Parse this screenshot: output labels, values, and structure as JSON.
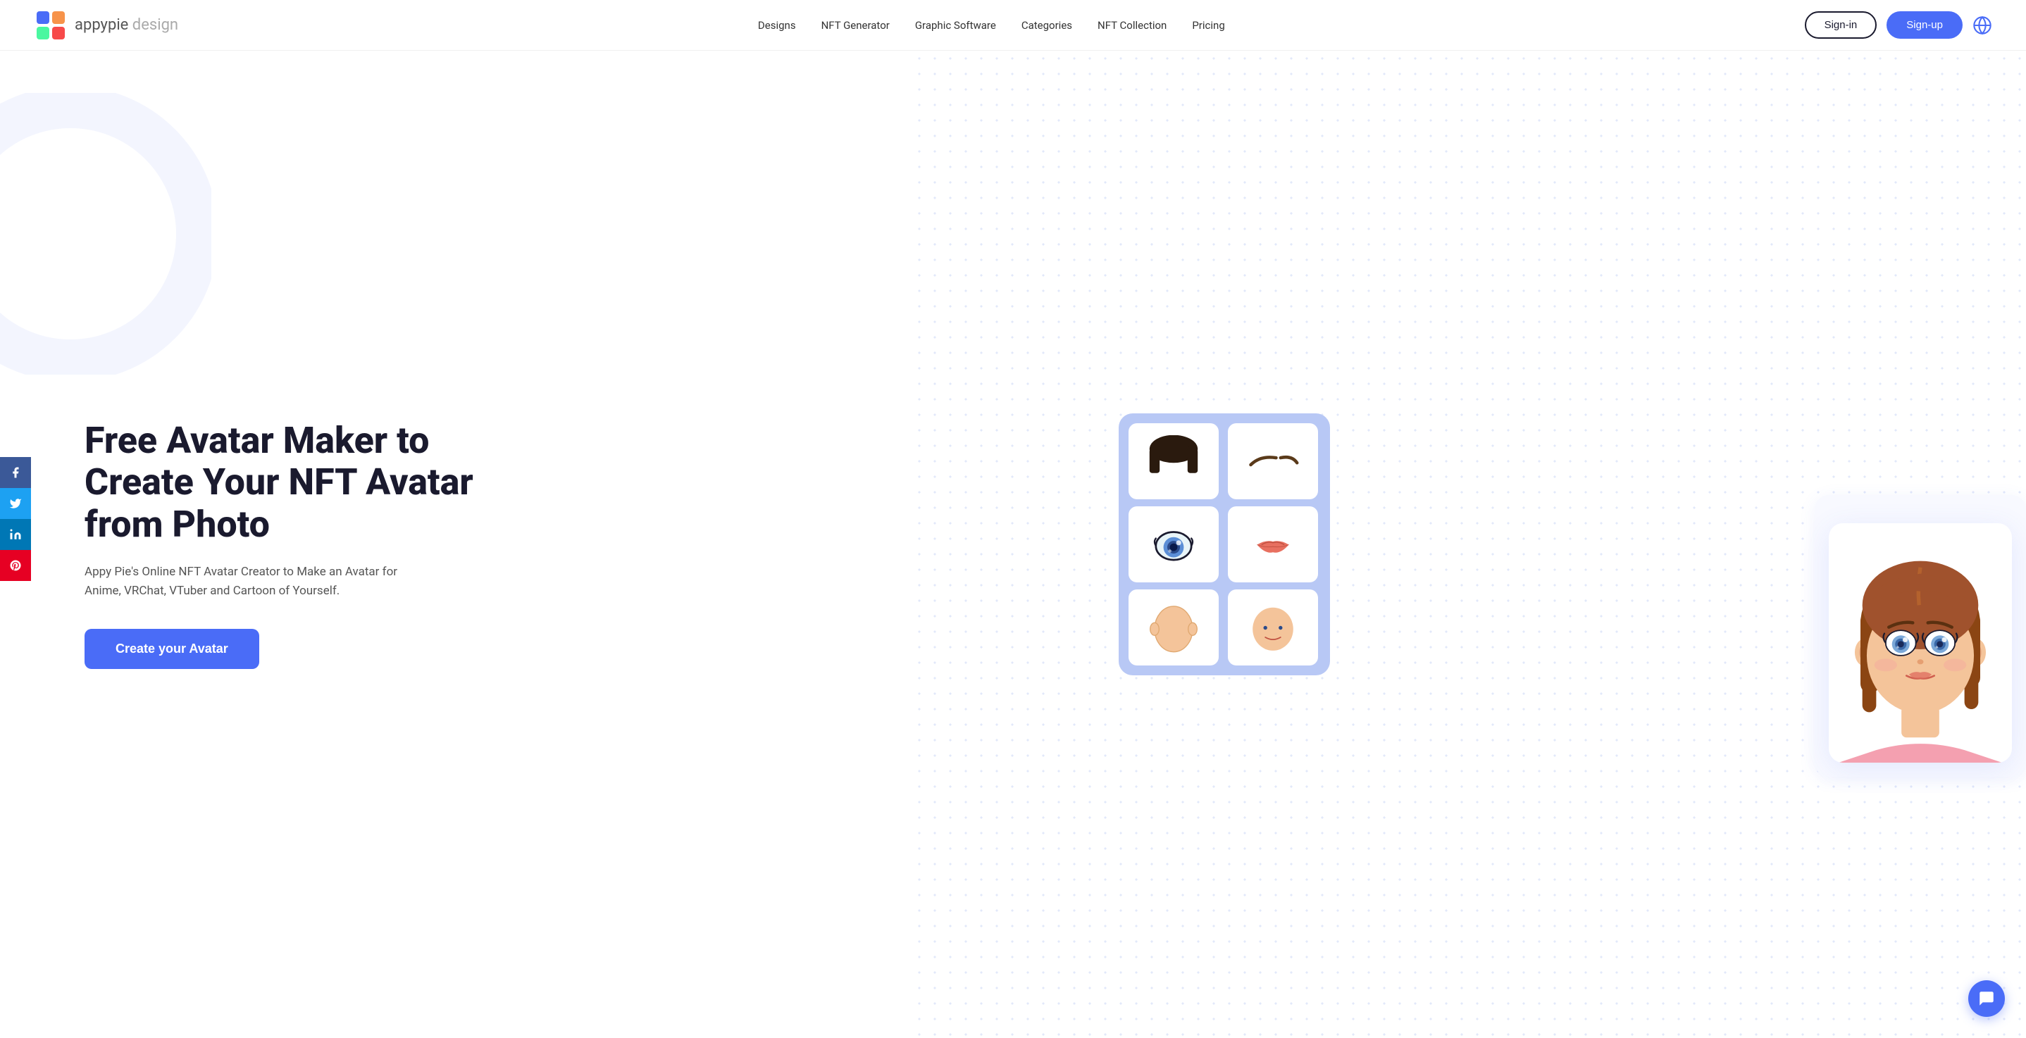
{
  "logo": {
    "brand": "appypie",
    "suffix": " design"
  },
  "nav": {
    "links": [
      {
        "label": "Designs",
        "id": "designs"
      },
      {
        "label": "NFT Generator",
        "id": "nft-generator"
      },
      {
        "label": "Graphic Software",
        "id": "graphic-software"
      },
      {
        "label": "Categories",
        "id": "categories"
      },
      {
        "label": "NFT Collection",
        "id": "nft-collection"
      },
      {
        "label": "Pricing",
        "id": "pricing"
      }
    ],
    "signin_label": "Sign-in",
    "signup_label": "Sign-up"
  },
  "social": [
    {
      "label": "f",
      "name": "facebook",
      "class": "social-fb"
    },
    {
      "label": "t",
      "name": "twitter",
      "class": "social-tw"
    },
    {
      "label": "in",
      "name": "linkedin",
      "class": "social-li"
    },
    {
      "label": "P",
      "name": "pinterest",
      "class": "social-pi"
    }
  ],
  "hero": {
    "title": "Free Avatar Maker to Create Your NFT Avatar from Photo",
    "subtitle": "Appy Pie's Online NFT Avatar Creator to Make an Avatar for Anime, VRChat, VTuber and Cartoon of Yourself.",
    "cta_label": "Create your Avatar"
  },
  "chat": {
    "icon": "💬"
  }
}
